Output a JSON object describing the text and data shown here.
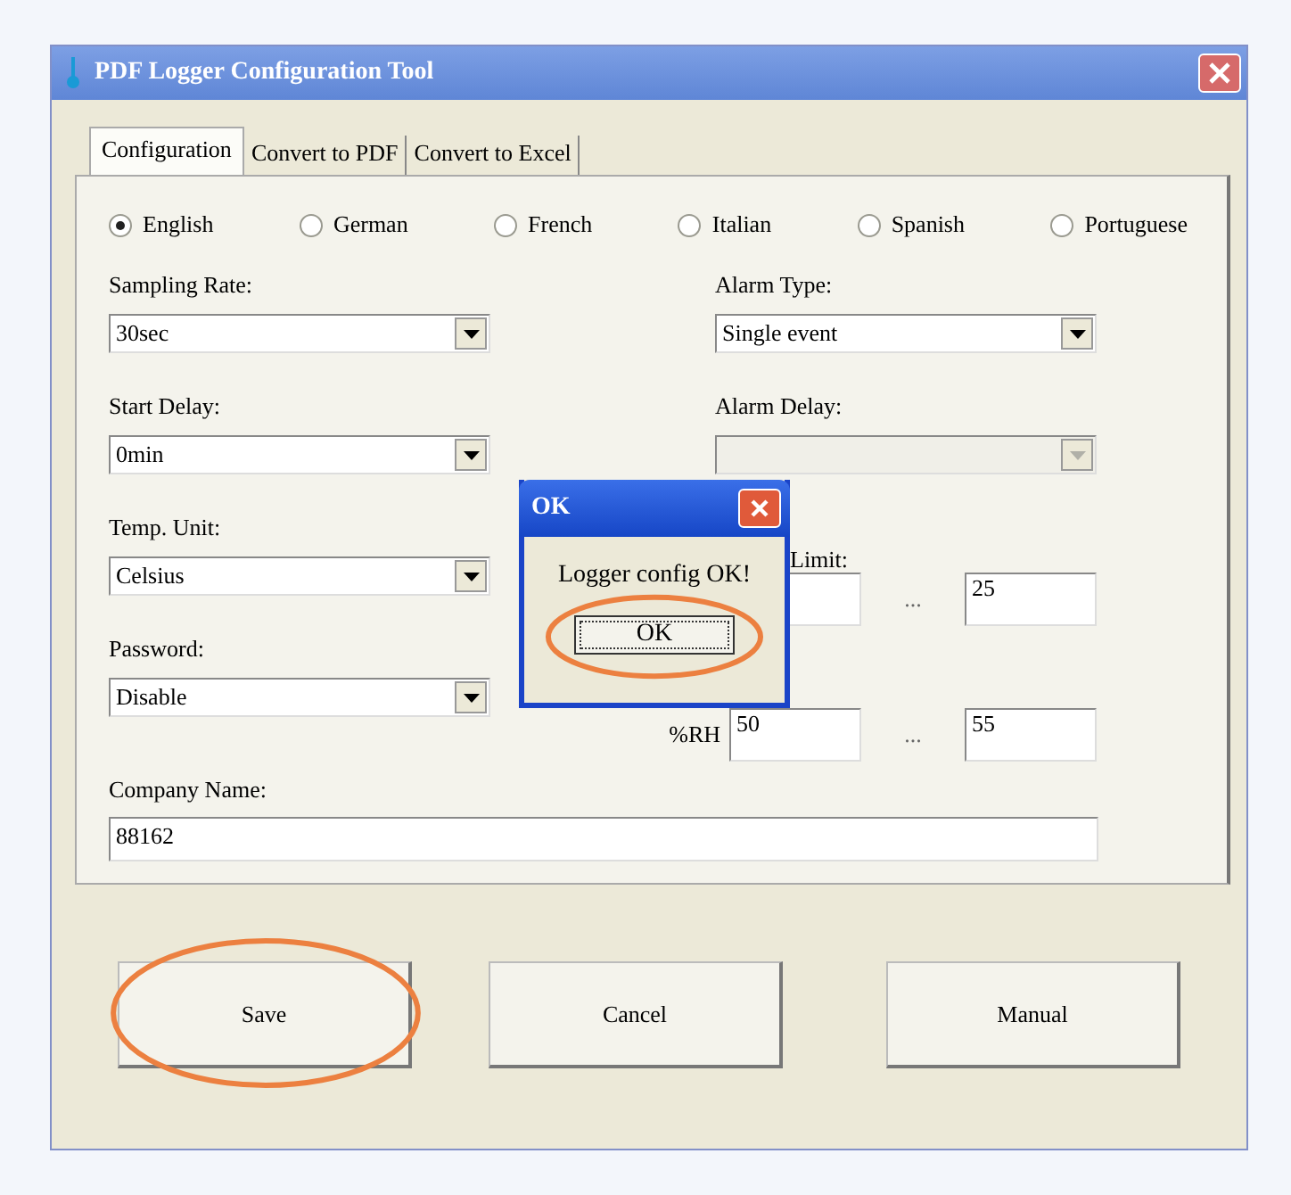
{
  "window": {
    "title": "PDF Logger Configuration Tool"
  },
  "tabs": [
    {
      "label": "Configuration",
      "selected": true
    },
    {
      "label": "Convert to PDF",
      "selected": false
    },
    {
      "label": "Convert to Excel",
      "selected": false
    }
  ],
  "languages": [
    {
      "label": "English",
      "selected": true
    },
    {
      "label": "German",
      "selected": false
    },
    {
      "label": "French",
      "selected": false
    },
    {
      "label": "Italian",
      "selected": false
    },
    {
      "label": "Spanish",
      "selected": false
    },
    {
      "label": "Portuguese",
      "selected": false
    }
  ],
  "left_fields": [
    {
      "kind": "dropdown",
      "label": "Sampling Rate:",
      "value": "30sec",
      "disabled": false
    },
    {
      "kind": "dropdown",
      "label": "Start Delay:",
      "value": "0min",
      "disabled": false
    },
    {
      "kind": "dropdown",
      "label": "Temp. Unit:",
      "value": "Celsius",
      "disabled": false
    },
    {
      "kind": "dropdown",
      "label": "Password:",
      "value": "Disable",
      "disabled": false
    }
  ],
  "right_fields": [
    {
      "kind": "dropdown",
      "label": "Alarm Type:",
      "value": "Single event",
      "disabled": false
    },
    {
      "kind": "dropdown",
      "label": "Alarm Delay:",
      "disabled": true
    },
    {
      "kind": "range",
      "label": "Limit:",
      "separator": "...",
      "high": "25"
    },
    {
      "kind": "range",
      "unit": "%RH",
      "low": "50",
      "separator": "...",
      "high": "55"
    }
  ],
  "company": {
    "label": "Company Name:",
    "value": "88162"
  },
  "buttons": [
    {
      "label": "Save",
      "highlighted": true
    },
    {
      "label": "Cancel",
      "highlighted": false
    },
    {
      "label": "Manual",
      "highlighted": false
    }
  ],
  "dialog": {
    "title": "OK",
    "message": "Logger config OK!",
    "button": {
      "label": "OK",
      "highlighted": true
    }
  }
}
